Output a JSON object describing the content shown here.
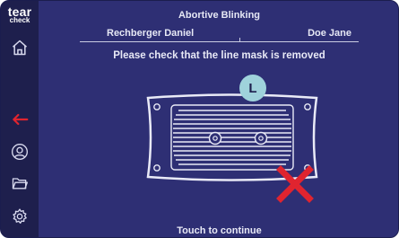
{
  "app": {
    "logo_line1": "tear",
    "logo_line2": "check"
  },
  "header": {
    "title": "Abortive Blinking",
    "patient_left": "Rechberger Daniel",
    "patient_right": "Doe Jane"
  },
  "main": {
    "instruction": "Please check that the line mask is removed",
    "eye_label": "L",
    "footer": "Touch to continue"
  },
  "sidebar": {
    "items": [
      {
        "name": "home-icon"
      },
      {
        "name": "back-arrow-icon"
      },
      {
        "name": "user-icon"
      },
      {
        "name": "folder-icon"
      },
      {
        "name": "gear-icon"
      }
    ]
  },
  "colors": {
    "background": "#2e2f74",
    "sidebar": "#1e1f4d",
    "accent_red": "#e0242f",
    "eye_badge": "#9fd2db"
  }
}
